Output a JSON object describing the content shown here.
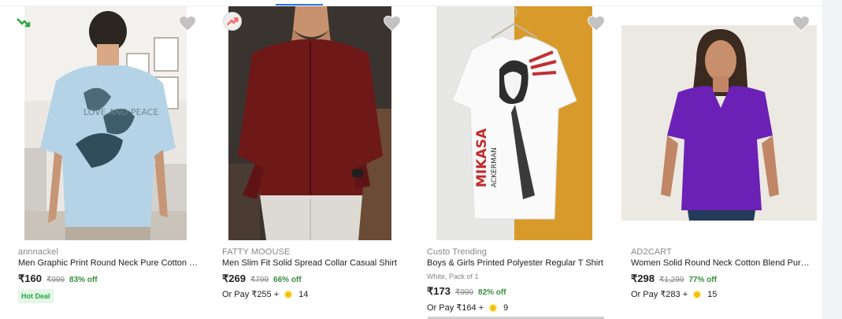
{
  "colors": {
    "accent": "#2874f0",
    "discount_green": "#388e3c",
    "hot_deal_bg": "#e4f7e9",
    "hot_deal_text": "#26a541",
    "heart_grey": "#c2c2c2",
    "muted_text": "#878787"
  },
  "products": [
    {
      "brand": "annnackel",
      "title": "Men Graphic Print Round Neck Pure Cotton Li...",
      "variant": "",
      "price": "₹160",
      "mrp": "₹999",
      "discount": "83% off",
      "pay_prefix": "",
      "pay_coins": "",
      "tag": "Hot Deal",
      "badge_icon": "trending-down-icon",
      "image_desc": "light blue oversized graphic t-shirt"
    },
    {
      "brand": "FATTY MOOUSE",
      "title": "Men Slim Fit Solid Spread Collar Casual Shirt",
      "variant": "",
      "price": "₹269",
      "mrp": "₹799",
      "discount": "66% off",
      "pay_prefix": "Or Pay ₹255 +",
      "pay_coins": "14",
      "tag": "",
      "badge_icon": "trending-up-icon",
      "image_desc": "maroon casual shirt"
    },
    {
      "brand": "Custo Trending",
      "title": "Boys & Girls Printed Polyester Regular T Shirt",
      "variant": "White, Pack of 1",
      "price": "₹173",
      "mrp": "₹999",
      "discount": "82% off",
      "pay_prefix": "Or Pay ₹164 +",
      "pay_coins": "9",
      "tag": "",
      "badge_icon": "",
      "image_desc": "white anime print t-shirt on hanger"
    },
    {
      "brand": "AD2CART",
      "title": "Women Solid Round Neck Cotton Blend Purpl...",
      "variant": "",
      "price": "₹298",
      "mrp": "₹1,299",
      "discount": "77% off",
      "pay_prefix": "Or Pay ₹283 +",
      "pay_coins": "15",
      "tag": "",
      "badge_icon": "",
      "image_desc": "purple v-neck top"
    }
  ],
  "image_text": {
    "love_and_peace": "LOVE AND PEACE",
    "mikasa": "MIKASA",
    "ackerman": "ACKERMAN"
  },
  "icons": {
    "wishlist": "heart-icon",
    "supercoin": "supercoin-icon"
  }
}
